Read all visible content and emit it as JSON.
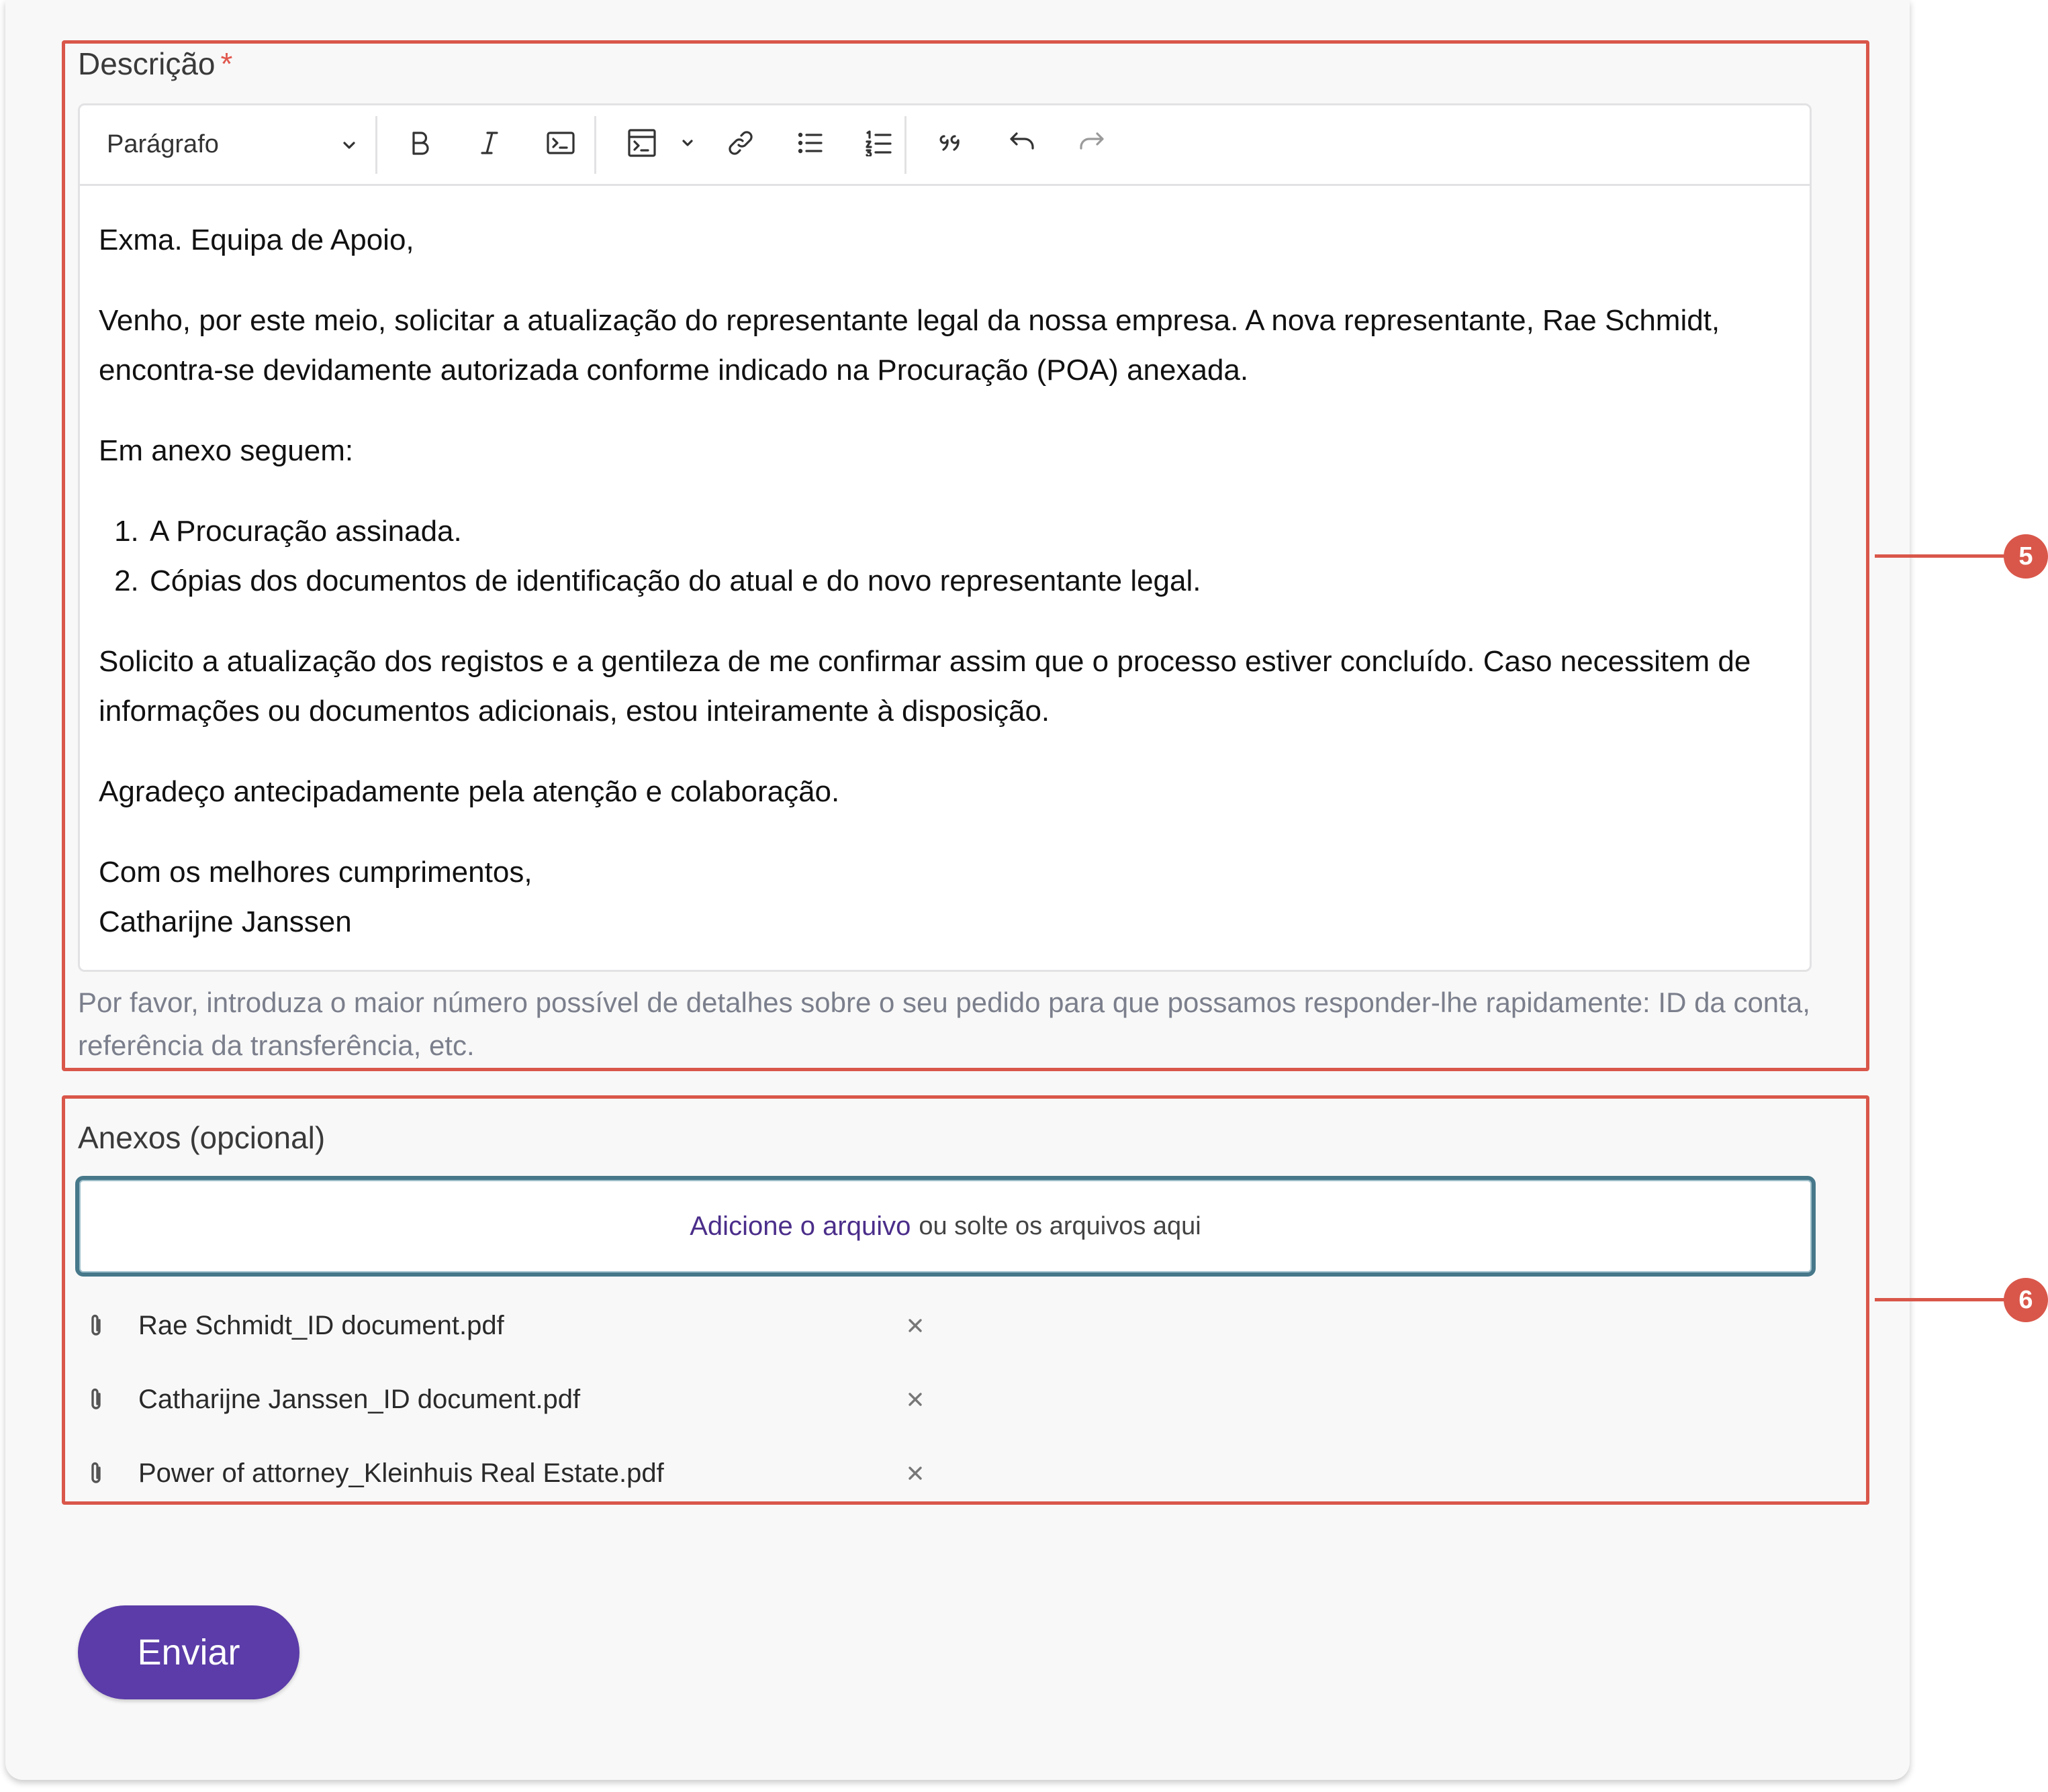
{
  "description": {
    "label": "Descrição",
    "required_mark": "*",
    "toolbar": {
      "paragraph_select": "Parágrafo",
      "icons": [
        "bold-icon",
        "italic-icon",
        "code-icon",
        "code-block-icon",
        "link-icon",
        "bulleted-list-icon",
        "numbered-list-icon",
        "blockquote-icon",
        "undo-icon",
        "redo-icon"
      ]
    },
    "body": {
      "greeting": "Exma. Equipa de Apoio,",
      "para1": "Venho, por este meio, solicitar a atualização do representante legal da nossa empresa. A nova representante, Rae Schmidt, encontra-se devidamente autorizada conforme indicado na Procuração (POA) anexada.",
      "para2": "Em anexo seguem:",
      "list": [
        "A Procuração assinada.",
        "Cópias dos documentos de identificação do atual e do novo representante legal."
      ],
      "para3": "Solicito a atualização dos registos e a gentileza de me confirmar assim que o processo estiver concluído. Caso necessitem de informações ou documentos adicionais, estou inteiramente à disposição.",
      "para4": "Agradeço antecipadamente pela atenção e colaboração.",
      "closing": "Com os melhores cumprimentos,",
      "signature": "Catharijne Janssen"
    },
    "helper_text": "Por favor, introduza o maior número possível de detalhes sobre o seu pedido para que possamos responder-lhe rapidamente: ID da conta, referência da transferência, etc."
  },
  "attachments": {
    "label": "Anexos (opcional)",
    "dropzone_link": "Adicione o arquivo",
    "dropzone_text": "ou solte os arquivos aqui",
    "files": [
      {
        "name": "Rae Schmidt_ID document.pdf"
      },
      {
        "name": "Catharijne Janssen_ID document.pdf"
      },
      {
        "name": "Power of attorney_Kleinhuis Real Estate.pdf"
      }
    ]
  },
  "submit_label": "Enviar",
  "callouts": [
    "5",
    "6"
  ],
  "colors": {
    "callout": "#d9574a",
    "primary_button": "#5b3ca8",
    "link": "#4b2e8a",
    "dropzone_border": "#46788a"
  }
}
